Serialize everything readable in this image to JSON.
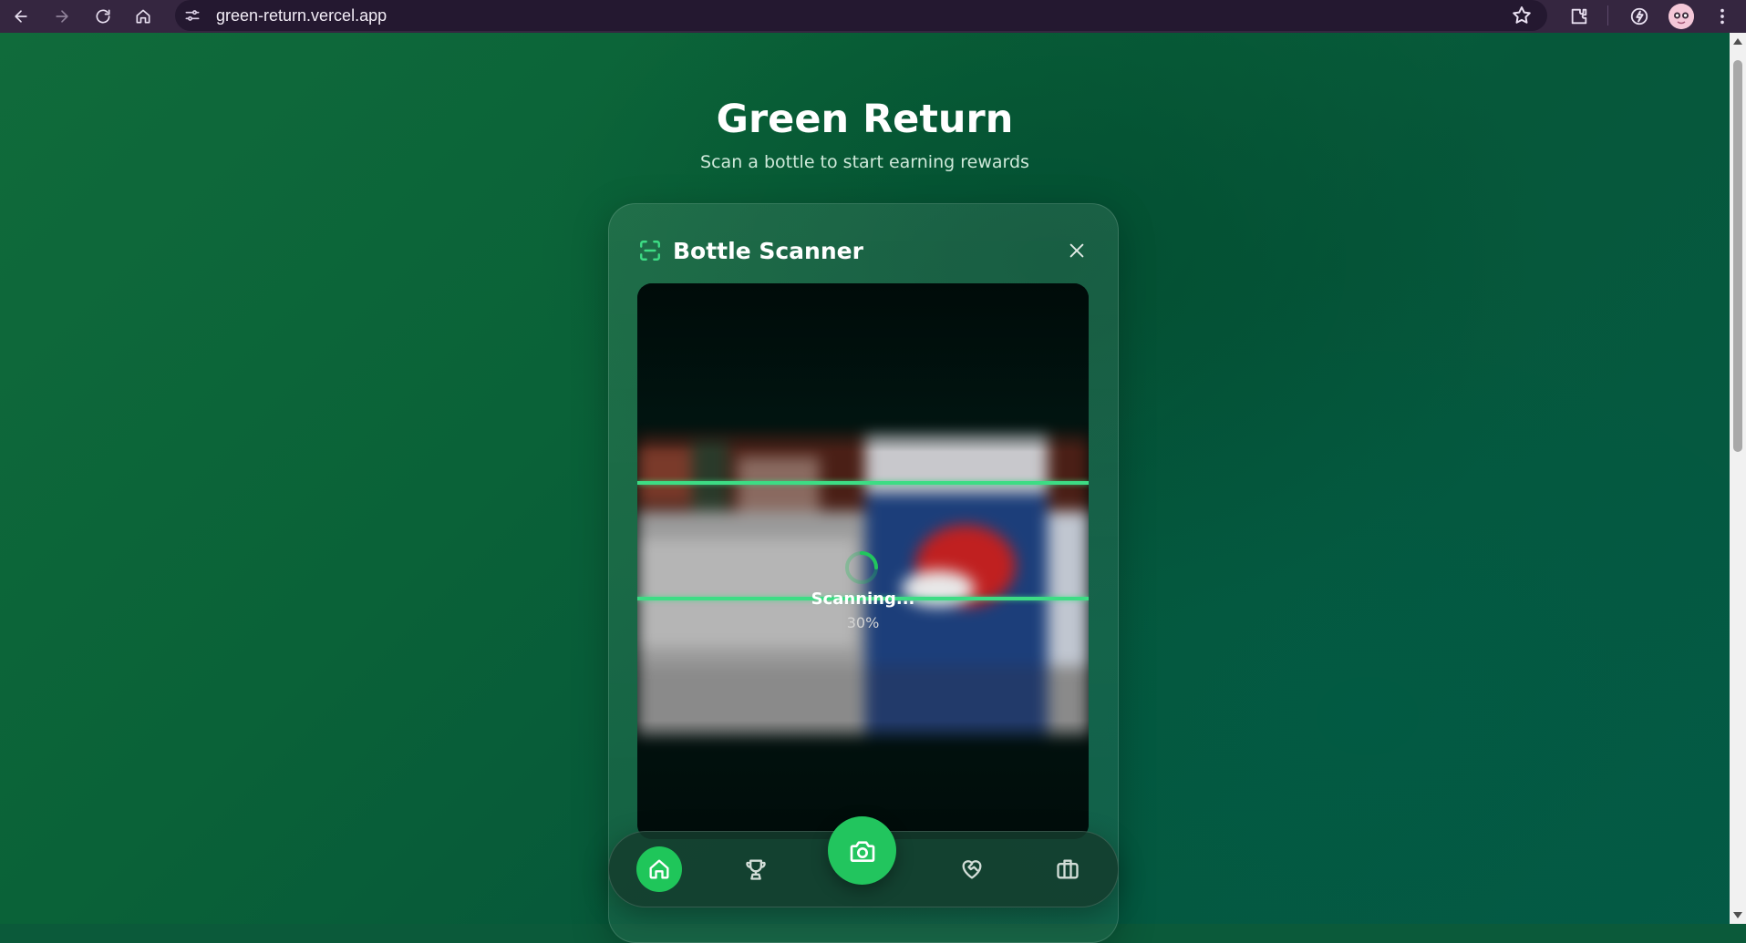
{
  "browser": {
    "url": "green-return.vercel.app"
  },
  "page": {
    "title": "Green Return",
    "subtitle": "Scan a bottle to start earning rewards"
  },
  "scanner": {
    "title": "Bottle Scanner",
    "status": "Scanning...",
    "progress_text": "30%",
    "progress": 0.3
  },
  "bottom_nav": {
    "items": [
      {
        "icon": "home-icon",
        "active": true
      },
      {
        "icon": "trophy-icon",
        "active": false
      },
      {
        "icon": "camera-icon",
        "active": false,
        "primary": true
      },
      {
        "icon": "heart-handshake-icon",
        "active": false
      },
      {
        "icon": "briefcase-icon",
        "active": false
      }
    ]
  },
  "colors": {
    "accent": "#22c55e",
    "scan_line": "#3ddc84",
    "browser_chrome": "#352640"
  }
}
